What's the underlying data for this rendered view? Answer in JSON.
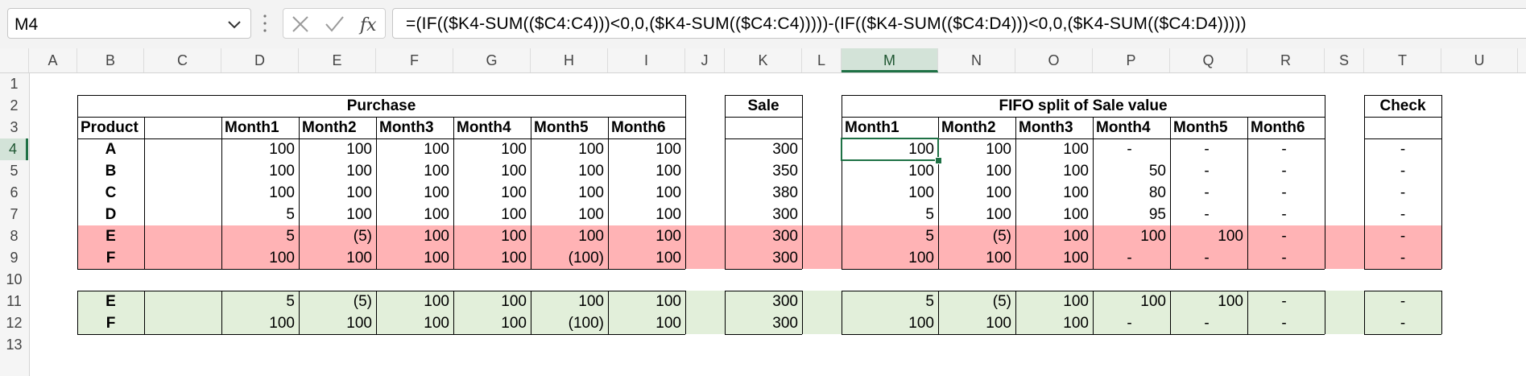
{
  "namebox": {
    "value": "M4"
  },
  "formula": {
    "text": "=(IF(($K4-SUM(($C4:C4)))<0,0,($K4-SUM(($C4:C4)))))-(IF(($K4-SUM(($C4:D4)))<0,0,($K4-SUM(($C4:D4)))))"
  },
  "columns": [
    "A",
    "B",
    "C",
    "D",
    "E",
    "F",
    "G",
    "H",
    "I",
    "J",
    "K",
    "L",
    "M",
    "N",
    "O",
    "P",
    "Q",
    "R",
    "S",
    "T",
    "U"
  ],
  "rows": [
    "1",
    "2",
    "3",
    "4",
    "5",
    "6",
    "7",
    "8",
    "9",
    "10",
    "11",
    "12",
    "13"
  ],
  "selected": {
    "column": "M",
    "row": "4"
  },
  "headers": {
    "purchase": "Purchase",
    "sale": "Sale",
    "fifo": "FIFO split of Sale value",
    "check": "Check",
    "product": "Product"
  },
  "months": [
    "Month1",
    "Month2",
    "Month3",
    "Month4",
    "Month5",
    "Month6"
  ],
  "table": [
    {
      "product": "A",
      "purchase": [
        "100",
        "100",
        "100",
        "100",
        "100",
        "100"
      ],
      "sale": "300",
      "fifo": [
        "100",
        "100",
        "100",
        "-",
        "-",
        "-"
      ],
      "check": "-"
    },
    {
      "product": "B",
      "purchase": [
        "100",
        "100",
        "100",
        "100",
        "100",
        "100"
      ],
      "sale": "350",
      "fifo": [
        "100",
        "100",
        "100",
        "50",
        "-",
        "-"
      ],
      "check": "-"
    },
    {
      "product": "C",
      "purchase": [
        "100",
        "100",
        "100",
        "100",
        "100",
        "100"
      ],
      "sale": "380",
      "fifo": [
        "100",
        "100",
        "100",
        "80",
        "-",
        "-"
      ],
      "check": "-"
    },
    {
      "product": "D",
      "purchase": [
        "5",
        "100",
        "100",
        "100",
        "100",
        "100"
      ],
      "sale": "300",
      "fifo": [
        "5",
        "100",
        "100",
        "95",
        "-",
        "-"
      ],
      "check": "-"
    },
    {
      "product": "E",
      "purchase": [
        "5",
        "(5)",
        "100",
        "100",
        "100",
        "100"
      ],
      "sale": "300",
      "fifo": [
        "5",
        "(5)",
        "100",
        "100",
        "100",
        "-"
      ],
      "check": "-"
    },
    {
      "product": "F",
      "purchase": [
        "100",
        "100",
        "100",
        "100",
        "(100)",
        "100"
      ],
      "sale": "300",
      "fifo": [
        "100",
        "100",
        "100",
        "-",
        "-",
        "-"
      ],
      "check": "-"
    },
    {
      "product": "E",
      "purchase": [
        "5",
        "(5)",
        "100",
        "100",
        "100",
        "100"
      ],
      "sale": "300",
      "fifo": [
        "5",
        "(5)",
        "100",
        "100",
        "100",
        "-"
      ],
      "check": "-"
    },
    {
      "product": "F",
      "purchase": [
        "100",
        "100",
        "100",
        "100",
        "(100)",
        "100"
      ],
      "sale": "300",
      "fifo": [
        "100",
        "100",
        "100",
        "-",
        "-",
        "-"
      ],
      "check": "-"
    }
  ],
  "colors": {
    "highlight_red": "#ffb3b5",
    "highlight_green": "#e2efda",
    "accent": "#1e7145"
  },
  "icons": {
    "dropdown": "chevron-down-icon",
    "cancel": "cancel-x-icon",
    "enter": "checkmark-icon",
    "function": "fx-icon"
  }
}
